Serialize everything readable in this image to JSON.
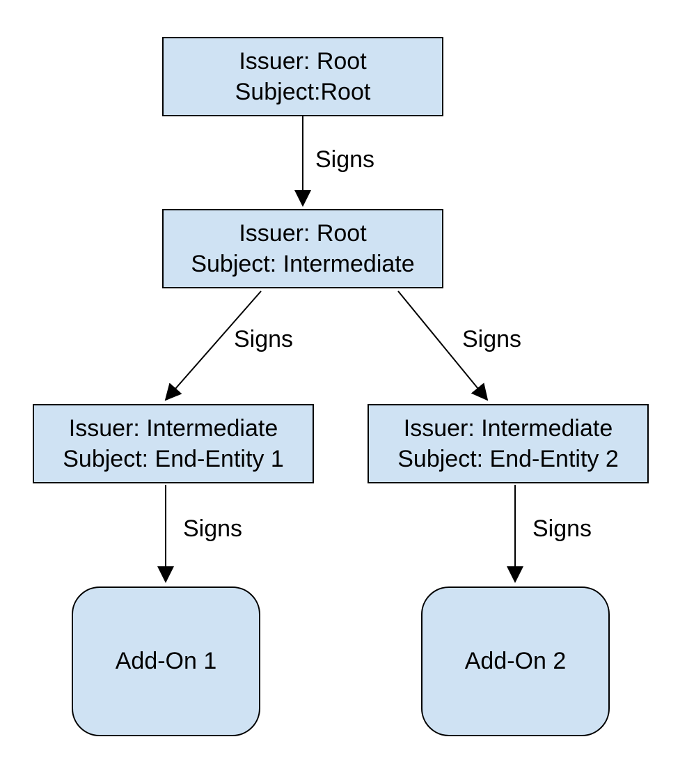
{
  "nodes": {
    "root": {
      "line1": "Issuer: Root",
      "line2": "Subject:Root"
    },
    "intermediate": {
      "line1": "Issuer: Root",
      "line2": "Subject: Intermediate"
    },
    "entity1": {
      "line1": "Issuer: Intermediate",
      "line2": "Subject: End-Entity 1"
    },
    "entity2": {
      "line1": "Issuer: Intermediate",
      "line2": "Subject: End-Entity 2"
    },
    "addon1": {
      "label": "Add-On 1"
    },
    "addon2": {
      "label": "Add-On 2"
    }
  },
  "edges": {
    "root_to_intermediate": "Signs",
    "intermediate_to_entity1": "Signs",
    "intermediate_to_entity2": "Signs",
    "entity1_to_addon1": "Signs",
    "entity2_to_addon2": "Signs"
  },
  "colors": {
    "node_fill": "#cfe2f3",
    "node_border": "#000000",
    "arrow": "#000000"
  }
}
